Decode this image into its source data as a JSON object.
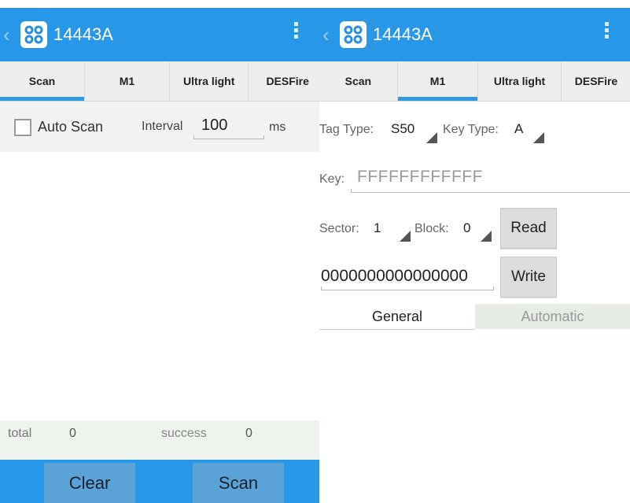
{
  "left": {
    "app_title": "14443A",
    "tabs": [
      "Scan",
      "M1",
      "Ultra light",
      "DESFire"
    ],
    "auto_scan_label": "Auto Scan",
    "interval_label": "Interval",
    "interval_value": "100",
    "interval_unit": "ms",
    "total_label": "total",
    "total_value": "0",
    "success_label": "success",
    "success_value": "0",
    "clear_button": "Clear",
    "scan_button": "Scan"
  },
  "right": {
    "app_title": "14443A",
    "tabs": [
      "Scan",
      "M1",
      "Ultra light",
      "DESFire"
    ],
    "tag_type_label": "Tag Type:",
    "tag_type_value": "S50",
    "key_type_label": "Key Type:",
    "key_type_value": "A",
    "key_label": "Key:",
    "key_value": "FFFFFFFFFFFF",
    "sector_label": "Sector:",
    "sector_value": "1",
    "block_label": "Block:",
    "block_value": "0",
    "read_button": "Read",
    "data_value": "0000000000000000",
    "write_button": "Write",
    "mode_tabs": [
      "General",
      "Automatic"
    ]
  },
  "colors": {
    "actionbar": "#2997e8",
    "tab_indicator": "#2d9ae2"
  },
  "icons": [
    "back-chevron-icon",
    "app-icon",
    "overflow-menu-icon"
  ]
}
